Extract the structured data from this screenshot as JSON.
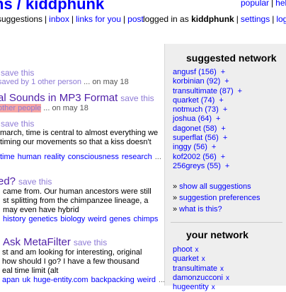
{
  "header": {
    "site_title": "ns / kiddphunk",
    "top_links": [
      "popular",
      "help"
    ],
    "nav": [
      {
        "label": "suggestions",
        "link": false
      },
      {
        "label": "inbox",
        "link": true
      },
      {
        "label": "links for you",
        "link": true
      },
      {
        "label": "post",
        "link": true
      }
    ],
    "logged_in_prefix": "logged in as",
    "username": "kiddphunk",
    "user_links": [
      "settings",
      "logout"
    ]
  },
  "items": [
    {
      "title": "",
      "save_label": "save this",
      "meta_saved_by": "saved by 1 other person",
      "meta_date": "... on may 18",
      "desc": [],
      "tags": []
    },
    {
      "title": "al Sounds in MP3 Format",
      "save_label": "save this",
      "meta_saved_by": "other people",
      "meta_date": "... on may 18",
      "desc": [],
      "tags": []
    },
    {
      "title": "",
      "save_label": "save this",
      "meta_saved_by": "",
      "meta_date": "",
      "desc": [
        "march, time is central to almost everything we",
        "timing our movements so that a kiss doesn't"
      ],
      "tags": [
        "time",
        "human",
        "reality",
        "consciousness",
        "research"
      ],
      "tags_more": "..."
    },
    {
      "title": "ed?",
      "save_label": "save this",
      "meta_saved_by": "",
      "meta_date": "",
      "desc": [
        "came from. Our human ancestors were still",
        "st splitting from the chimpanzee lineage, a",
        "may even have hybrid"
      ],
      "tags": [
        "history",
        "genetics",
        "biology",
        "weird",
        "genes",
        "chimps"
      ],
      "tags_more": ""
    },
    {
      "title": "Ask MetaFilter",
      "save_label": "save this",
      "meta_saved_by": "",
      "meta_date": "",
      "desc": [
        "st and am looking for interesting, original",
        "how should I go? I have a few thousand",
        "eal time limit (alt"
      ],
      "tags": [
        "apan",
        "uk",
        "huge-entity.com",
        "backpacking",
        "weird"
      ],
      "tags_more": "..."
    }
  ],
  "sidebar": {
    "suggested_title": "suggested network",
    "suggested": [
      {
        "name": "angusf",
        "count": "(156)"
      },
      {
        "name": "korbinian",
        "count": "(92)"
      },
      {
        "name": "transultimate",
        "count": "(87)"
      },
      {
        "name": "quarket",
        "count": "(74)"
      },
      {
        "name": "notmuch",
        "count": "(73)"
      },
      {
        "name": "joshua",
        "count": "(64)"
      },
      {
        "name": "dagonet",
        "count": "(58)"
      },
      {
        "name": "superflat",
        "count": "(56)"
      },
      {
        "name": "inggy",
        "count": "(56)"
      },
      {
        "name": "kof2002",
        "count": "(56)"
      },
      {
        "name": "256greys",
        "count": "(55)"
      }
    ],
    "plus_glyph": "+",
    "side_links": [
      "show all suggestions",
      "suggestion preferences",
      "what is this?"
    ],
    "arrow_glyph": "»",
    "your_network_title": "your network",
    "your_network": [
      "phoot",
      "quarket",
      "transultimate",
      "damonzucconi",
      "hugeentity"
    ],
    "x_glyph": "x"
  },
  "colors": {
    "link": "#0000ff",
    "visited": "#4f1fa8",
    "muted_link": "#8e7bd6",
    "highlight": "#f7a6a3",
    "sidebar_bg": "#eeeeee"
  }
}
